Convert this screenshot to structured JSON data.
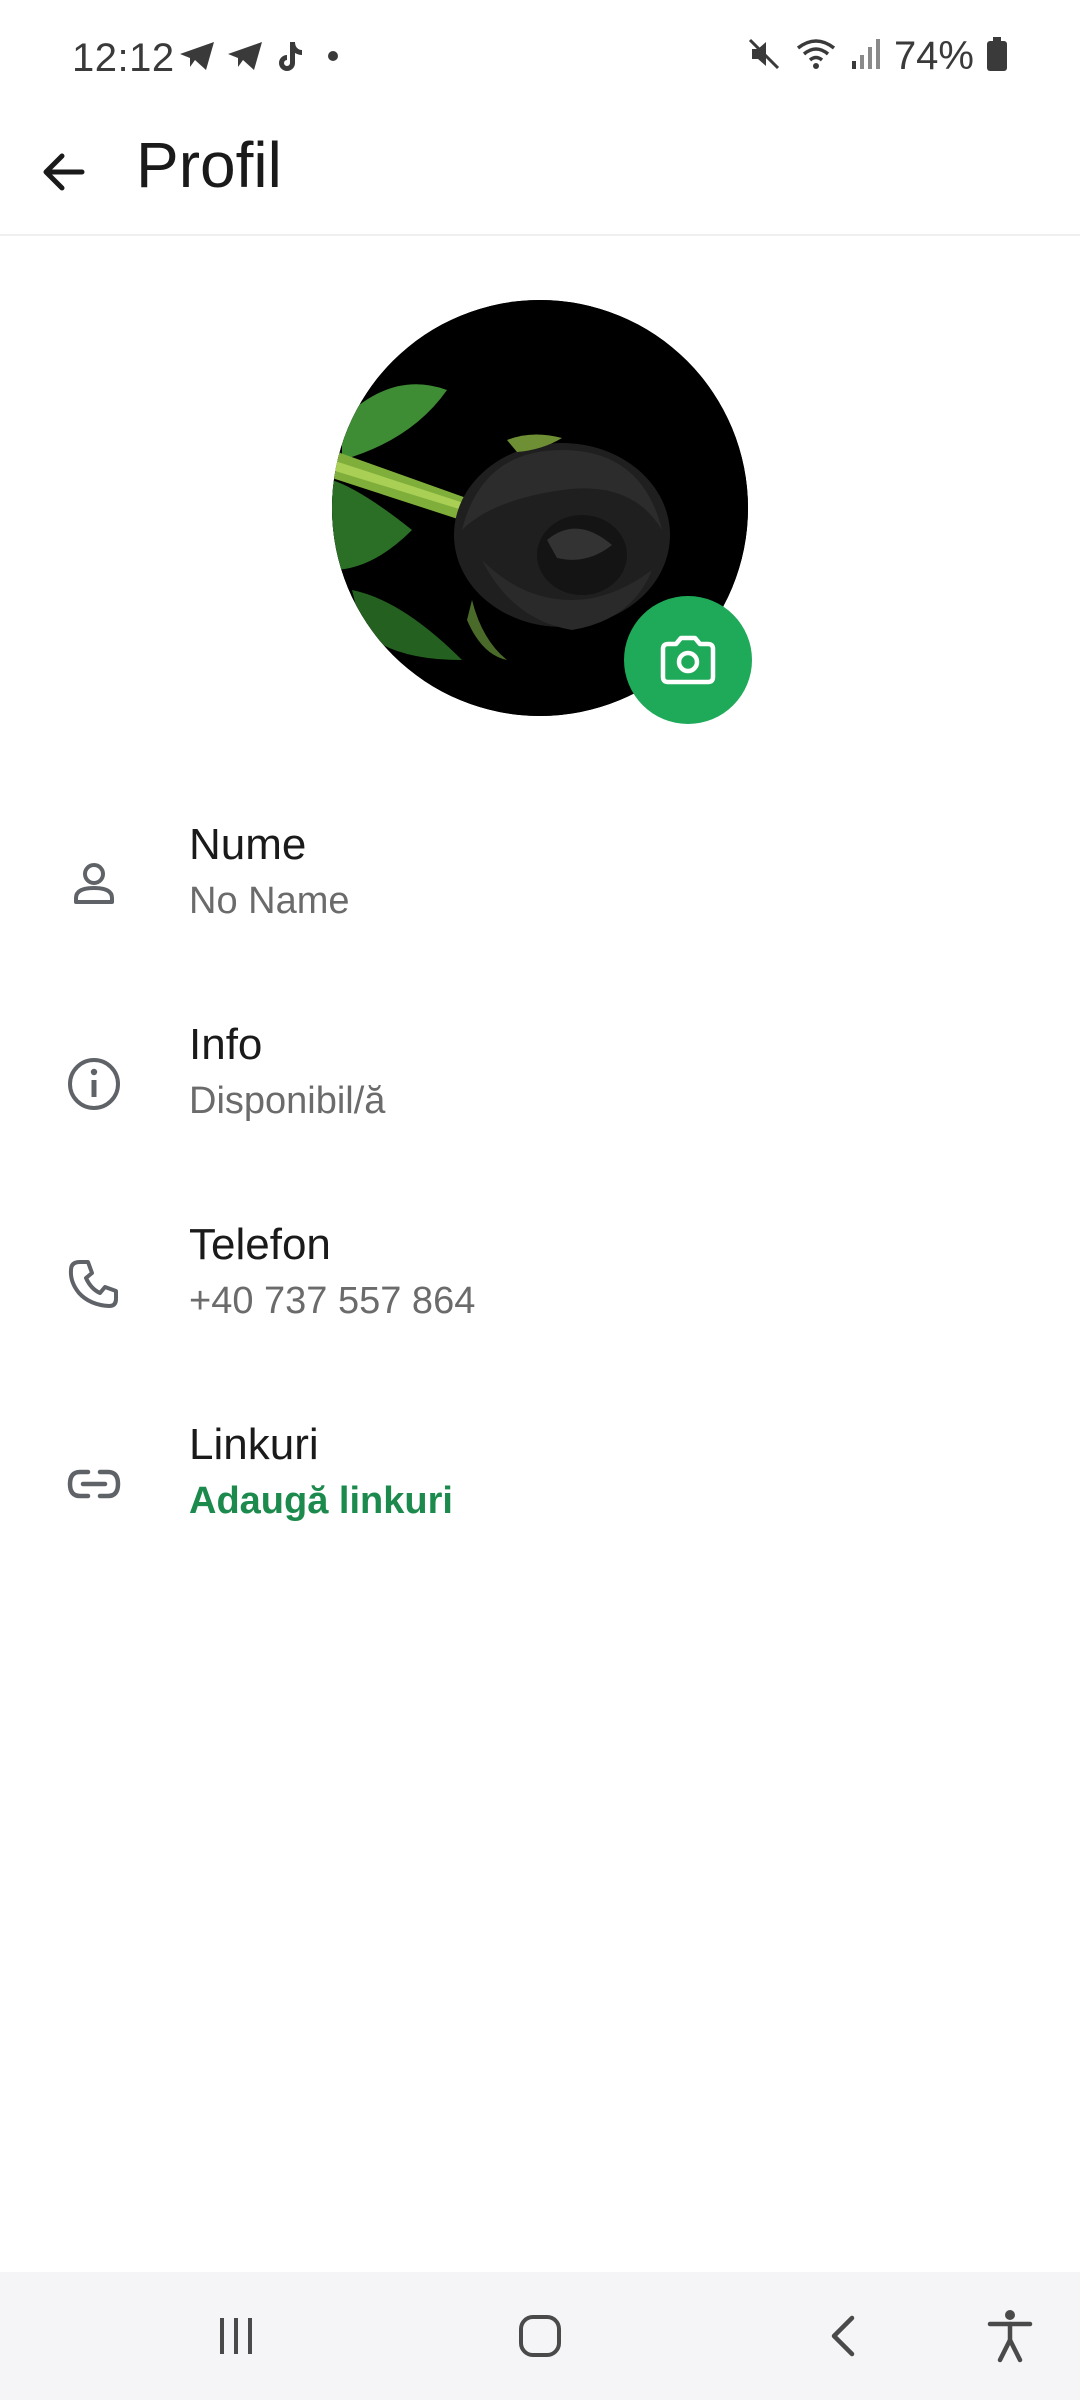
{
  "status_bar": {
    "time": "12:12",
    "battery_text": "74%",
    "left_icons": [
      "telegram-icon",
      "telegram-icon",
      "tiktok-icon",
      "notification-dot"
    ],
    "right_icons": [
      "mute-icon",
      "wifi-icon",
      "signal-icon",
      "battery-icon"
    ]
  },
  "app_bar": {
    "title": "Profil",
    "back_icon": "arrow-left-icon"
  },
  "avatar": {
    "camera_icon": "camera-icon",
    "accent": "#1faa59"
  },
  "rows": [
    {
      "icon": "person-icon",
      "title": "Nume",
      "value": "No Name"
    },
    {
      "icon": "info-icon",
      "title": "Info",
      "value": "Disponibil/ă"
    },
    {
      "icon": "phone-icon",
      "title": "Telefon",
      "value": "+40 737 557 864"
    },
    {
      "icon": "link-icon",
      "title": "Linkuri",
      "value": "Adaugă linkuri"
    }
  ],
  "colors": {
    "accent_green": "#1faa59",
    "link_green": "#1b8a4c",
    "secondary_text": "#6b6b6b"
  },
  "nav_bar": {
    "icons": [
      "recent-apps-icon",
      "home-icon",
      "back-icon",
      "accessibility-icon"
    ]
  }
}
